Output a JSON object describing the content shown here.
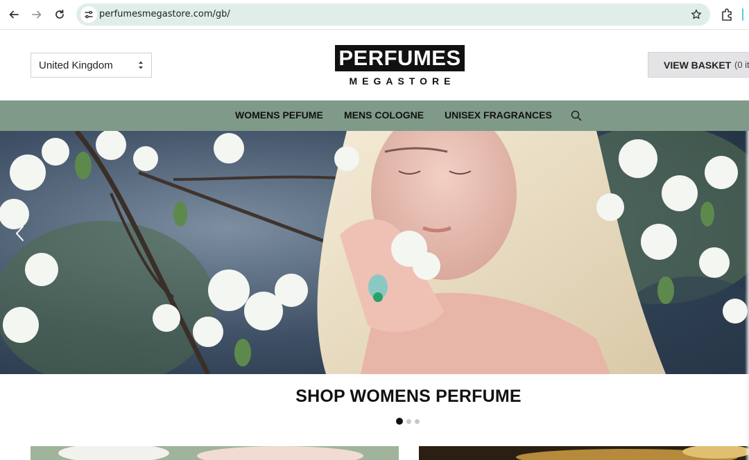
{
  "browser": {
    "url": "perfumesmegastore.com/gb/",
    "icons": [
      "back-arrow-icon",
      "forward-arrow-icon",
      "reload-icon",
      "site-settings-icon",
      "bookmark-star-icon",
      "extensions-puzzle-icon"
    ]
  },
  "header": {
    "country": "United Kingdom",
    "logo_top": "PERFUMES",
    "logo_bottom": "MEGASTORE",
    "basket_label": "VIEW BASKET",
    "basket_count": "(0 it"
  },
  "nav": {
    "items": [
      {
        "label": "WOMENS PEFUME"
      },
      {
        "label": "MENS COLOGNE"
      },
      {
        "label": "UNISEX FRAGRANCES"
      }
    ]
  },
  "hero": {
    "caption": "SHOP WOMENS PERFUME",
    "slides": 3,
    "active_slide": 1
  },
  "colors": {
    "nav_bg": "#7f9a89",
    "omnibox_bg": "#dfeee8",
    "basket_bg": "#e4e4e6"
  }
}
